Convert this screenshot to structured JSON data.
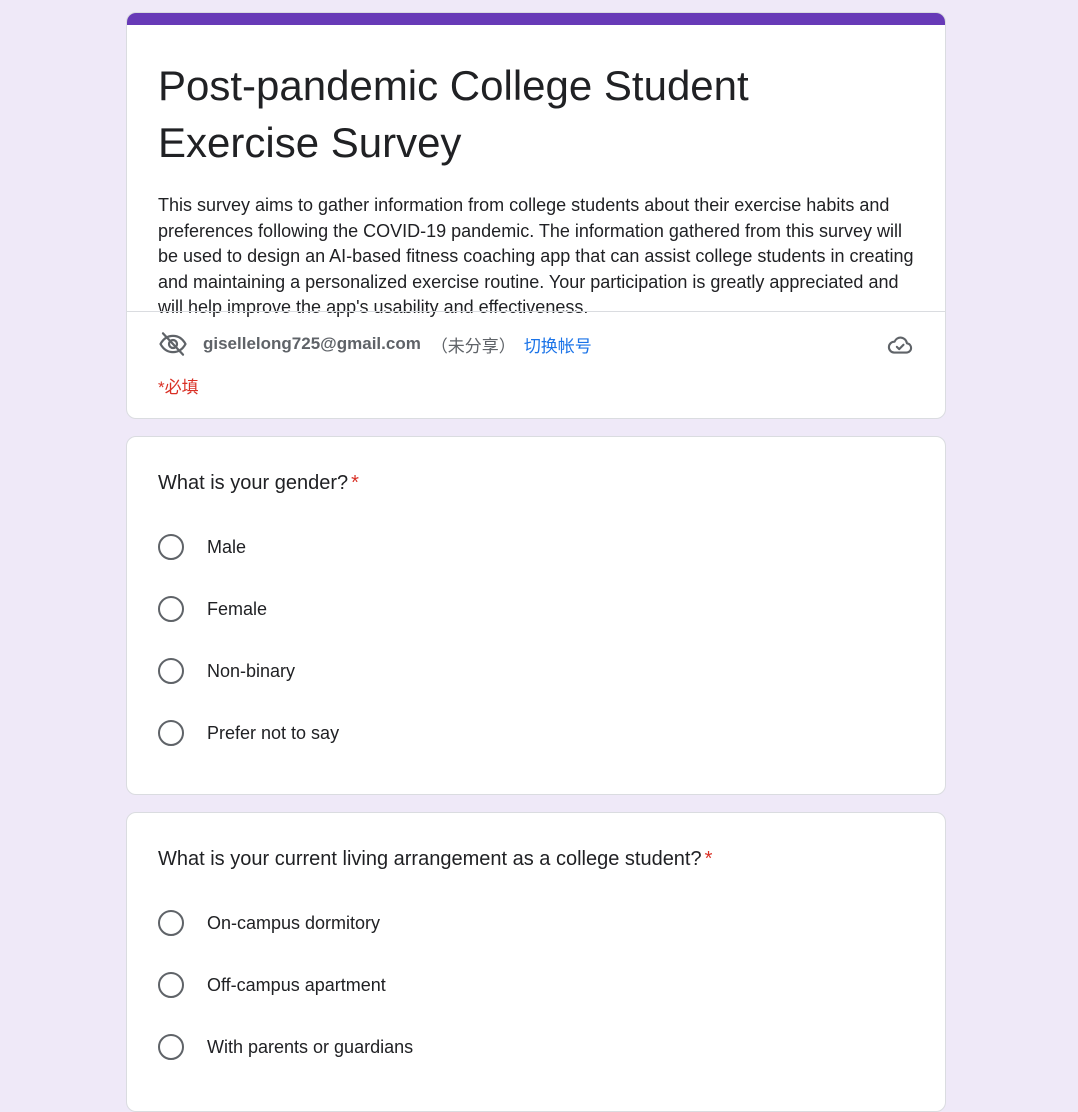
{
  "form": {
    "title": "Post-pandemic College Student Exercise Survey",
    "description": "This survey aims to gather information from college students about their exercise habits and preferences following the COVID-19 pandemic. The information gathered from this survey will be used to design an AI-based fitness coaching app that can assist college students in creating and maintaining a personalized exercise routine. Your participation is greatly appreciated and will help improve the app's usability and effectiveness.",
    "accent_color": "#673ab7",
    "background_color": "#efe9f8"
  },
  "account": {
    "email": "gisellelong725@gmail.com",
    "share_status": "（未分享）",
    "switch_label": "切换帐号",
    "privacy_icon": "eye-off-icon",
    "save_status_icon": "cloud-check-icon"
  },
  "required_note": "*必填",
  "questions": [
    {
      "text": "What is your gender?",
      "required_marker": "*",
      "options": [
        "Male",
        "Female",
        "Non-binary",
        "Prefer not to say"
      ]
    },
    {
      "text": "What is your current living arrangement as a college student?",
      "required_marker": "*",
      "options": [
        "On-campus dormitory",
        "Off-campus apartment",
        "With parents or guardians"
      ]
    }
  ]
}
